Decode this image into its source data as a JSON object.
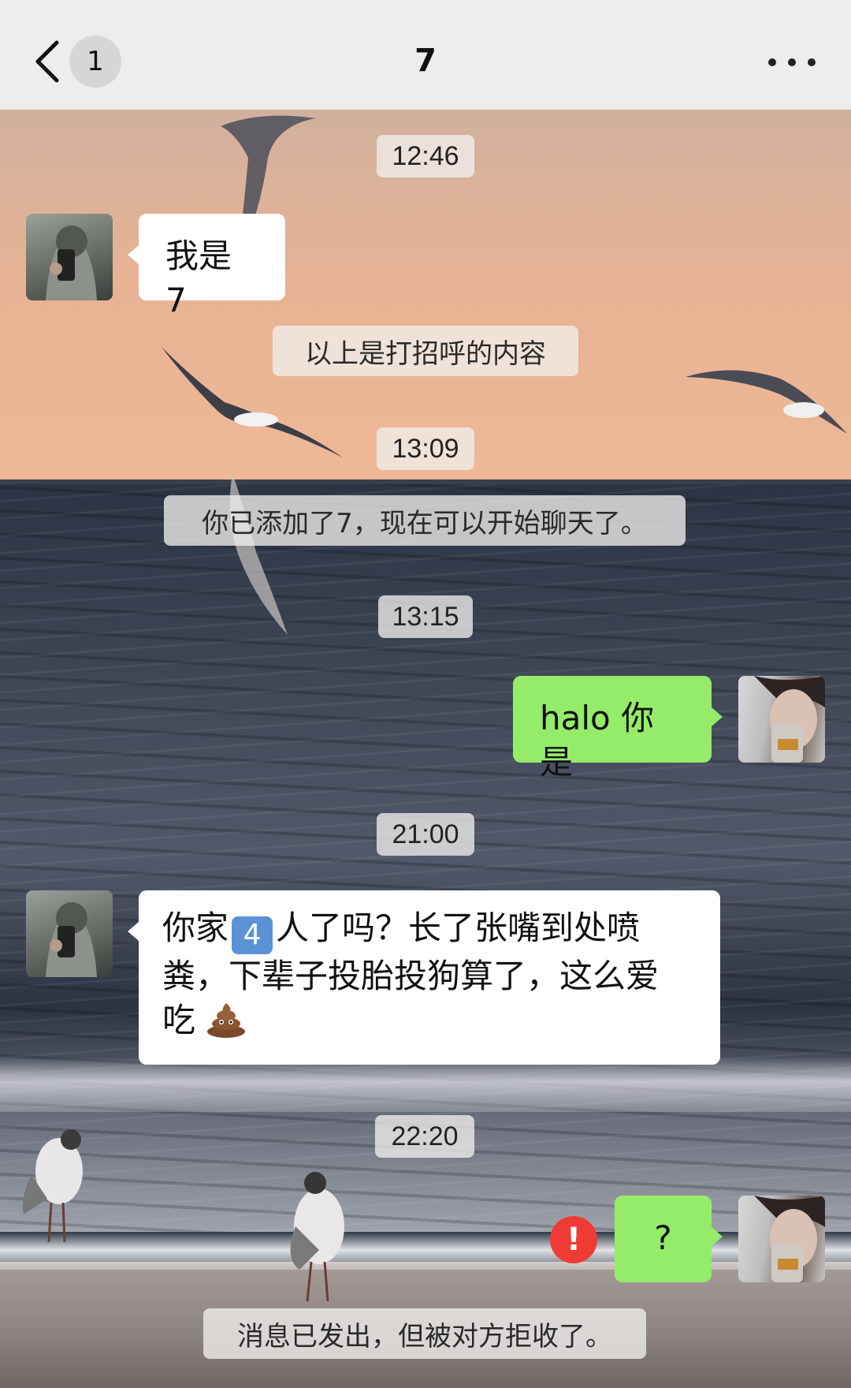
{
  "header": {
    "unread_count": "1",
    "title": "7"
  },
  "messages": {
    "time1": "12:46",
    "msg1": "我是 7",
    "sys1": "以上是打招呼的内容",
    "time2": "13:09",
    "sys2": "你已添加了7，现在可以开始聊天了。",
    "time3": "13:15",
    "msg2": "halo 你是",
    "time4": "21:00",
    "msg3_part1": "你家",
    "msg3_emoji_number": "4",
    "msg3_part2": "人了吗？长了张嘴到处喷",
    "msg3_line2": "粪，下辈子投胎投狗算了，这么爱",
    "msg3_line3": "吃",
    "time5": "22:20",
    "msg4": "?",
    "error_mark": "!",
    "sys3": "消息已发出，但被对方拒收了。"
  },
  "icons": {
    "back": "chevron-left-icon",
    "more": "more-dots-icon",
    "poop": "poop-emoji-icon",
    "error": "error-exclamation-icon"
  },
  "colors": {
    "header_bg": "#ededed",
    "bubble_self": "#95ec69",
    "bubble_other": "#ffffff",
    "error_red": "#f03b35"
  }
}
